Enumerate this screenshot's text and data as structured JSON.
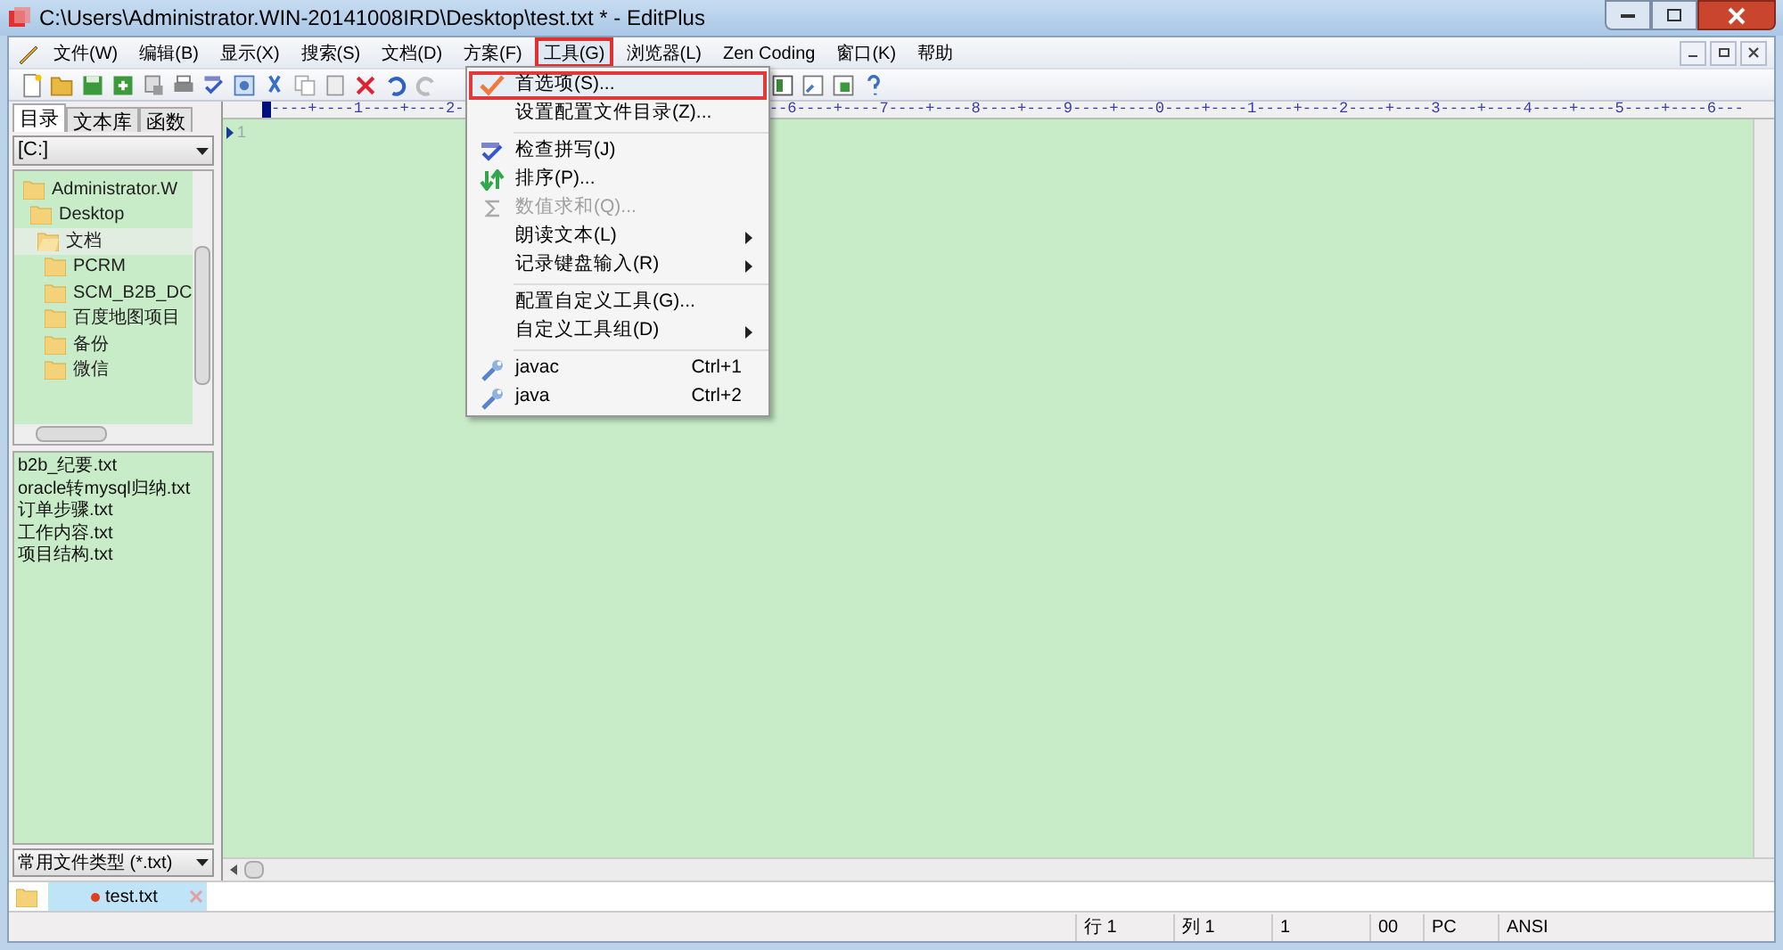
{
  "window": {
    "title": "C:\\Users\\Administrator.WIN-20141008IRD\\Desktop\\test.txt * - EditPlus"
  },
  "menu_bar": [
    {
      "label": "文件(W)",
      "selected": false
    },
    {
      "label": "编辑(B)",
      "selected": false
    },
    {
      "label": "显示(X)",
      "selected": false
    },
    {
      "label": "搜索(S)",
      "selected": false
    },
    {
      "label": "文档(D)",
      "selected": false
    },
    {
      "label": "方案(F)",
      "selected": false
    },
    {
      "label": "工具(G)",
      "selected": true
    },
    {
      "label": "浏览器(L)",
      "selected": false
    },
    {
      "label": "Zen Coding",
      "selected": false
    },
    {
      "label": "窗口(K)",
      "selected": false
    },
    {
      "label": "帮助",
      "selected": false
    }
  ],
  "tools_menu": [
    {
      "kind": "item",
      "label": "首选项(S)...",
      "selected": true,
      "disabled": false,
      "submenu": false
    },
    {
      "kind": "item",
      "label": "设置配置文件目录(Z)...",
      "selected": false,
      "disabled": false,
      "submenu": false
    },
    {
      "kind": "separator"
    },
    {
      "kind": "item",
      "label": "检查拼写(J)",
      "selected": false,
      "disabled": false,
      "submenu": false
    },
    {
      "kind": "item",
      "label": "排序(P)...",
      "selected": false,
      "disabled": false,
      "submenu": false
    },
    {
      "kind": "item",
      "label": "数值求和(Q)...",
      "selected": false,
      "disabled": true,
      "submenu": false
    },
    {
      "kind": "item",
      "label": "朗读文本(L)",
      "selected": false,
      "disabled": false,
      "submenu": true
    },
    {
      "kind": "item",
      "label": "记录键盘输入(R)",
      "selected": false,
      "disabled": false,
      "submenu": true
    },
    {
      "kind": "separator"
    },
    {
      "kind": "item",
      "label": "配置自定义工具(G)...",
      "selected": false,
      "disabled": false,
      "submenu": false
    },
    {
      "kind": "item",
      "label": "自定义工具组(D)",
      "selected": false,
      "disabled": false,
      "submenu": true
    },
    {
      "kind": "separator"
    },
    {
      "kind": "item",
      "label": "javac",
      "shortcut": "Ctrl+1",
      "selected": false,
      "disabled": false,
      "submenu": false
    },
    {
      "kind": "item",
      "label": "java",
      "shortcut": "Ctrl+2",
      "selected": false,
      "disabled": false,
      "submenu": false
    }
  ],
  "sidebar": {
    "tabs": [
      {
        "label": "目录",
        "selected": true
      },
      {
        "label": "文本库",
        "selected": false
      },
      {
        "label": "函数",
        "selected": false
      }
    ],
    "drive": "[C:]",
    "tree": [
      {
        "label": "Administrator.W",
        "selected": false,
        "children": [
          {
            "label": "Desktop",
            "selected": false,
            "children": [
              {
                "label": "文档",
                "selected": true,
                "children": [
                  {
                    "label": "PCRM",
                    "selected": false
                  },
                  {
                    "label": "SCM_B2B_DC",
                    "selected": false
                  },
                  {
                    "label": "百度地图项目",
                    "selected": false
                  },
                  {
                    "label": "备份",
                    "selected": false
                  },
                  {
                    "label": "微信",
                    "selected": false
                  }
                ]
              }
            ]
          }
        ]
      }
    ],
    "files": [
      "b2b_纪要.txt",
      "oracle转mysql归纳.txt",
      "订单步骤.txt",
      "工作内容.txt",
      "项目结构.txt"
    ],
    "filter": "常用文件类型 (*.txt)"
  },
  "editor": {
    "ruler_left": "----+----1----+----2-",
    "ruler_right": "--6----+----7----+----8----+----9----+----0----+----1----+----2----+----3----+----4----+----5----+----6---",
    "line_numbers": [
      "1"
    ]
  },
  "document_tabs": [
    {
      "label": "test.txt",
      "modified": true,
      "selected": true
    }
  ],
  "status_bar": [
    "行 1",
    "列 1",
    "1",
    "00",
    "PC",
    "ANSI"
  ]
}
